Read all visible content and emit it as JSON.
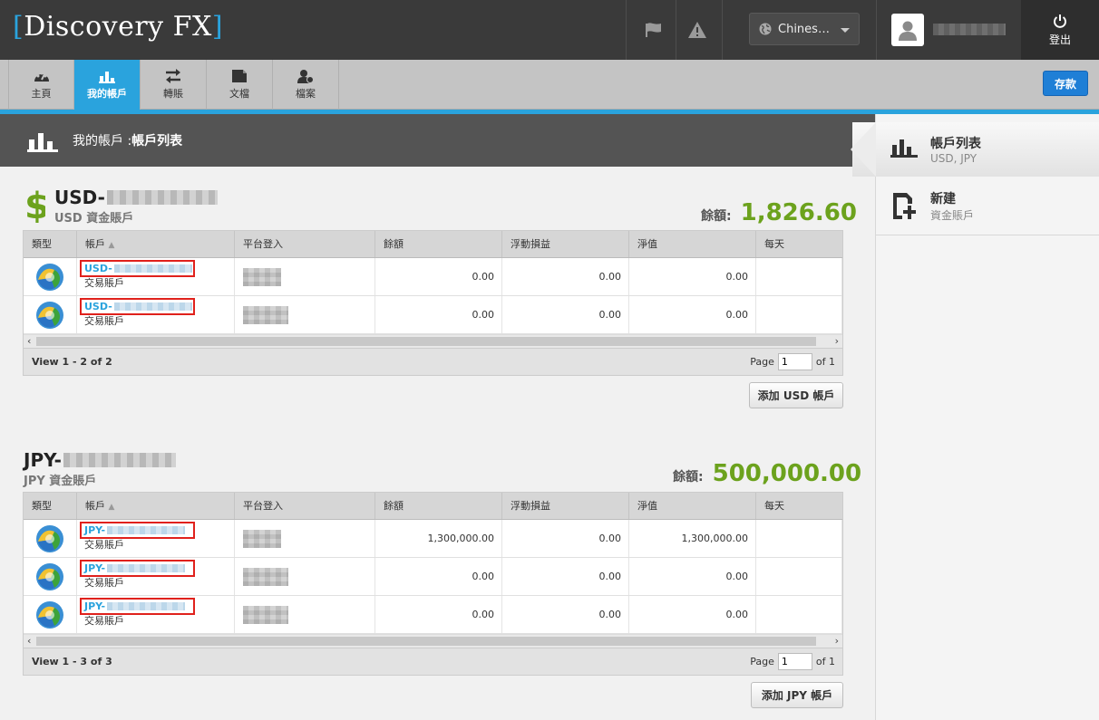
{
  "header": {
    "logo_open": "[",
    "logo_text": "Discovery FX",
    "logo_close": "]",
    "language": "Chines…",
    "logout_label": "登出"
  },
  "nav": {
    "tabs": [
      {
        "label": "主頁",
        "icon": "dashboard-icon"
      },
      {
        "label": "我的帳戶",
        "icon": "bar-chart-icon",
        "active": true
      },
      {
        "label": "轉賬",
        "icon": "transfer-arrows-icon"
      },
      {
        "label": "文檔",
        "icon": "document-icon"
      },
      {
        "label": "檔案",
        "icon": "profile-icon"
      }
    ],
    "deposit_label": "存款"
  },
  "title": {
    "prefix": "我的帳戶 : ",
    "page": "帳戶列表"
  },
  "sidebar": {
    "items": [
      {
        "title": "帳戶列表",
        "sub": "USD, JPY",
        "icon": "bar-chart-icon"
      },
      {
        "title": "新建",
        "sub": "資金賬戶",
        "icon": "new-document-icon"
      }
    ]
  },
  "columns": [
    "類型",
    "帳戶",
    "平台登入",
    "餘額",
    "浮動損益",
    "淨值",
    "每天"
  ],
  "accounts": [
    {
      "code": "USD-",
      "subtitle": "USD 資金賬戶",
      "balance_label": "餘額:",
      "balance": "1,826.60",
      "rows": [
        {
          "acct": "USD-",
          "kind": "交易賬戶",
          "balance": "0.00",
          "pl": "0.00",
          "equity": "0.00"
        },
        {
          "acct": "USD-",
          "kind": "交易賬戶",
          "balance": "0.00",
          "pl": "0.00",
          "equity": "0.00"
        }
      ],
      "view": "View 1 - 2 of 2",
      "page_label": "Page",
      "page": "1",
      "of": "of 1",
      "add_label": "添加 USD 帳戶"
    },
    {
      "code": "JPY-",
      "subtitle": "JPY 資金賬戶",
      "balance_label": "餘額:",
      "balance": "500,000.00",
      "rows": [
        {
          "acct": "JPY-",
          "kind": "交易賬戶",
          "balance": "1,300,000.00",
          "pl": "0.00",
          "equity": "1,300,000.00"
        },
        {
          "acct": "JPY-",
          "kind": "交易賬戶",
          "balance": "0.00",
          "pl": "0.00",
          "equity": "0.00"
        },
        {
          "acct": "JPY-",
          "kind": "交易賬戶",
          "balance": "0.00",
          "pl": "0.00",
          "equity": "0.00"
        }
      ],
      "view": "View 1 - 3 of 3",
      "page_label": "Page",
      "page": "1",
      "of": "of 1",
      "add_label": "添加 JPY 帳戶"
    }
  ],
  "colors": {
    "accent": "#2aa3dd",
    "balance_green": "#6ca21d",
    "deposit_blue": "#1f7fd6",
    "highlight_red": "#e0211c"
  }
}
